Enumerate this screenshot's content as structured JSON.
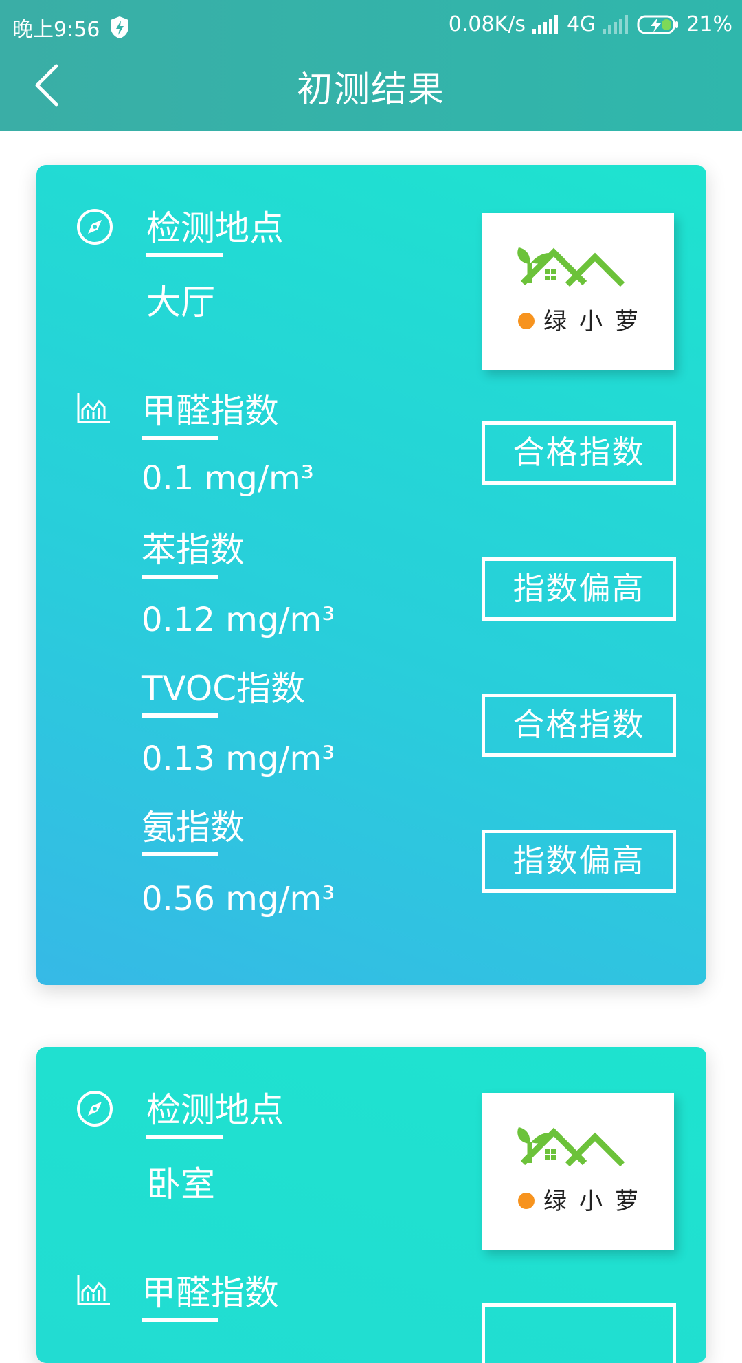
{
  "status_bar": {
    "time": "晚上9:56",
    "speed": "0.08K/s",
    "network": "4G",
    "battery": "21%"
  },
  "nav": {
    "title": "初测结果"
  },
  "cards": [
    {
      "location_label": "检测地点",
      "location_value": "大厅",
      "logo_text": "绿小萝",
      "metrics": [
        {
          "label": "甲醛指数",
          "value": "0.1 mg/m³",
          "status": "合格指数"
        },
        {
          "label": "苯指数",
          "value": "0.12 mg/m³",
          "status": "指数偏高"
        },
        {
          "label": "TVOC指数",
          "value": "0.13 mg/m³",
          "status": "合格指数"
        },
        {
          "label": "氨指数",
          "value": "0.56 mg/m³",
          "status": "指数偏高"
        }
      ]
    },
    {
      "location_label": "检测地点",
      "location_value": "卧室",
      "logo_text": "绿小萝",
      "metrics": [
        {
          "label": "甲醛指数"
        }
      ]
    }
  ],
  "colors": {
    "header": "#34b3a9",
    "card_top": "#1ee3cf",
    "card_bottom": "#36b9e6",
    "logo_green": "#6cc23a",
    "logo_orange": "#f7931e"
  }
}
